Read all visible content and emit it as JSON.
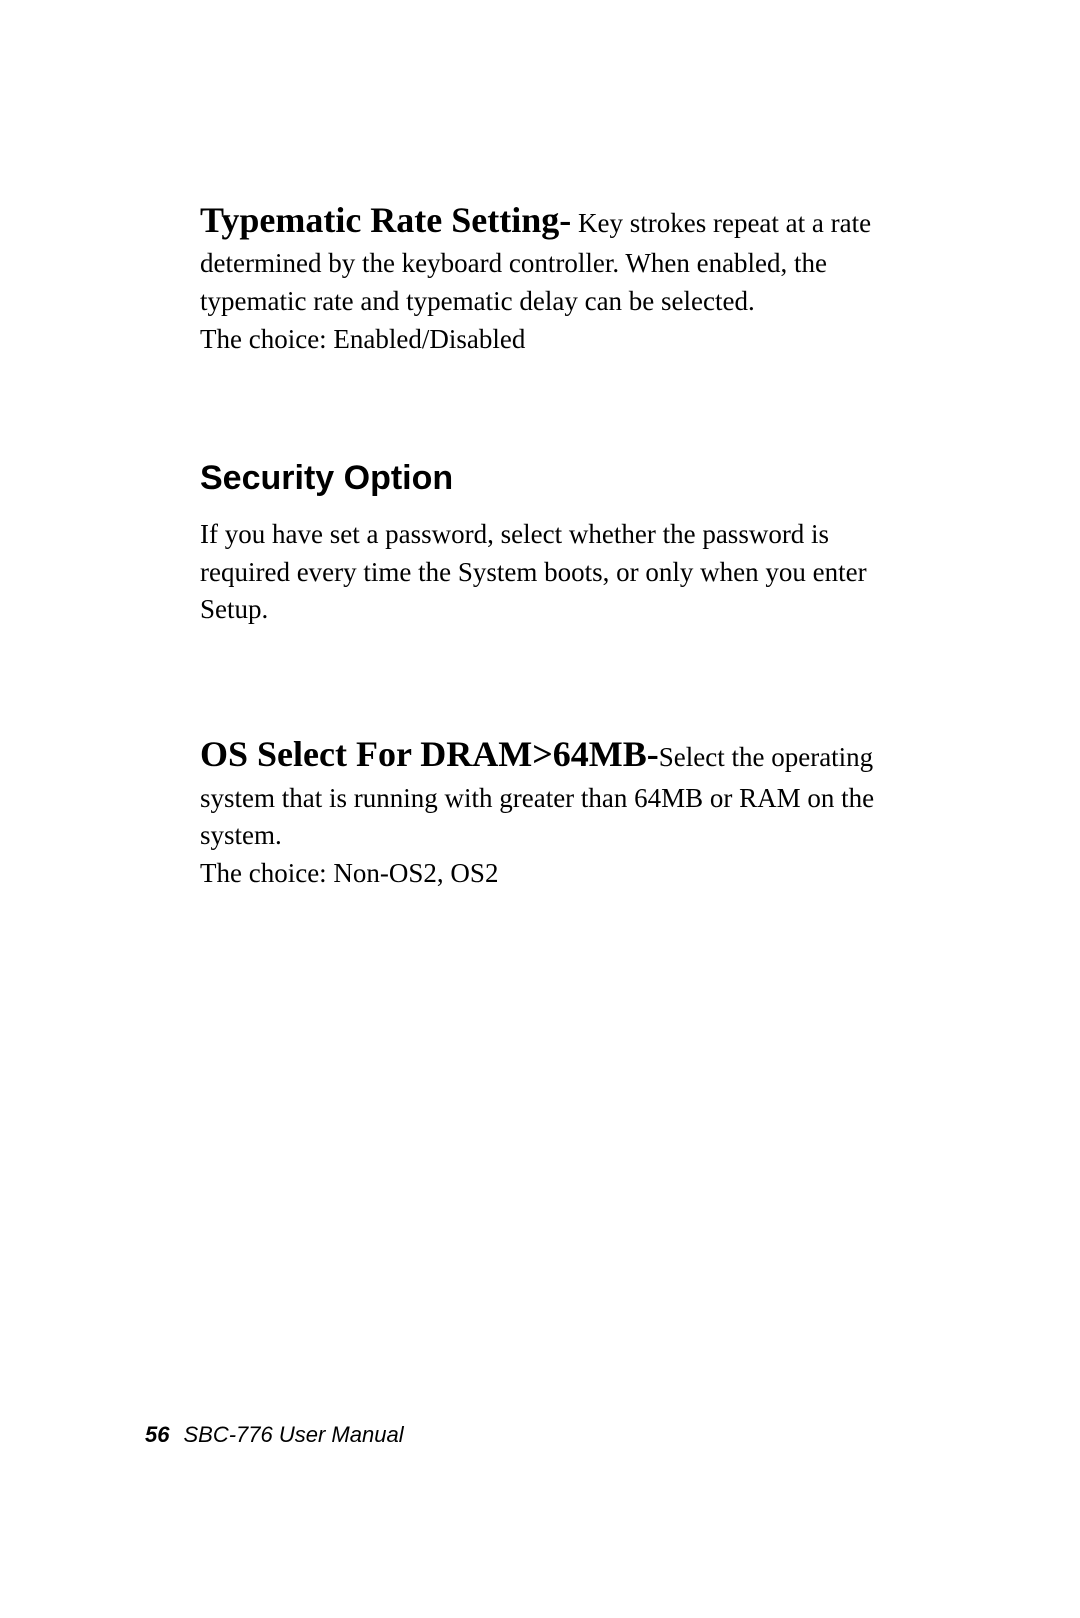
{
  "section1": {
    "heading": "Typematic Rate Setting-",
    "body": " Key strokes repeat at a rate determined by the keyboard controller.  When enabled, the typematic rate and typematic delay can be selected.",
    "choice": "The choice:  Enabled/Disabled"
  },
  "section2": {
    "heading": "Security Option",
    "body": "If you have set a password, select whether the password is required every time the System boots, or only when    you enter Setup."
  },
  "section3": {
    "heading": "OS Select For DRAM>64MB-",
    "body": "Select the operating system that is running with greater than 64MB or RAM on the system.",
    "choice": "The choice:  Non-OS2, OS2"
  },
  "footer": {
    "page_number": "56",
    "doc_title": "SBC-776 User Manual"
  }
}
